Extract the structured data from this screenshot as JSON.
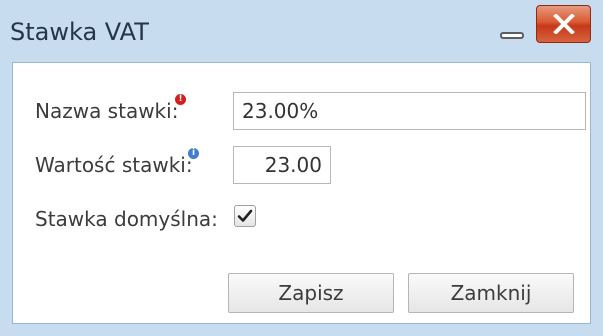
{
  "window": {
    "title": "Stawka VAT",
    "close_label": "X"
  },
  "form": {
    "name": {
      "label": "Nazwa stawki:",
      "value": "23.00%",
      "marker": "!"
    },
    "value": {
      "label": "Wartość stawki:",
      "value": "23.00",
      "marker": "i"
    },
    "default": {
      "label": "Stawka domyślna:",
      "checked": true
    }
  },
  "buttons": {
    "save_label": "Zapisz",
    "close_label": "Zamknij"
  },
  "colors": {
    "titlebar_bg": "#c7dcef",
    "close_button": "#d9592f",
    "required_icon": "#d51d1d",
    "info_icon": "#3f7fd1"
  },
  "icons": {
    "close": "close-icon",
    "minimize": "minimize-icon",
    "required": "required-icon",
    "info": "info-icon",
    "checkmark": "checkmark-icon"
  }
}
